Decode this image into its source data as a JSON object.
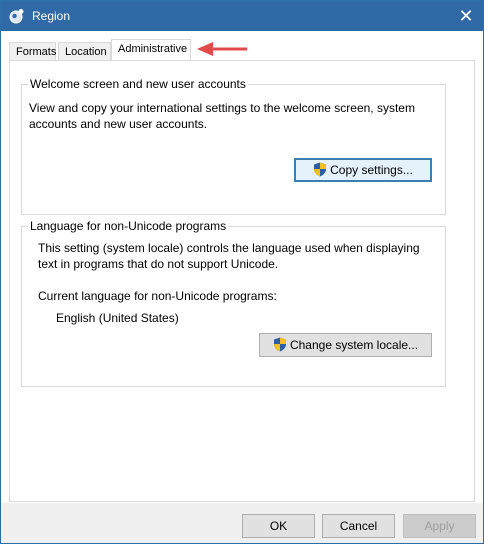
{
  "window": {
    "title": "Region",
    "close_glyph": "✕"
  },
  "tabs": [
    {
      "label": "Formats"
    },
    {
      "label": "Location"
    },
    {
      "label": "Administrative",
      "active": true
    }
  ],
  "annotation": {
    "arrow_color": "#e34b4b"
  },
  "welcome_group": {
    "title": "Welcome screen and new user accounts",
    "description_line1": "View and copy your international settings to the welcome screen, system",
    "description_line2": "accounts and new user accounts.",
    "button_label": "Copy settings..."
  },
  "unicode_group": {
    "title": "Language for non-Unicode programs",
    "description_line1": "This setting (system locale) controls the language used when displaying",
    "description_line2": "text in programs that do not support Unicode.",
    "current_label": "Current language for non-Unicode programs:",
    "current_value": "English (United States)",
    "button_label": "Change system locale..."
  },
  "footer": {
    "ok_label": "OK",
    "cancel_label": "Cancel",
    "apply_label": "Apply"
  },
  "colors": {
    "titlebar": "#2f6aa6",
    "accent": "#3c7fb1"
  },
  "icons": {
    "title": "globe-icon",
    "shield": "uac-shield-icon"
  }
}
